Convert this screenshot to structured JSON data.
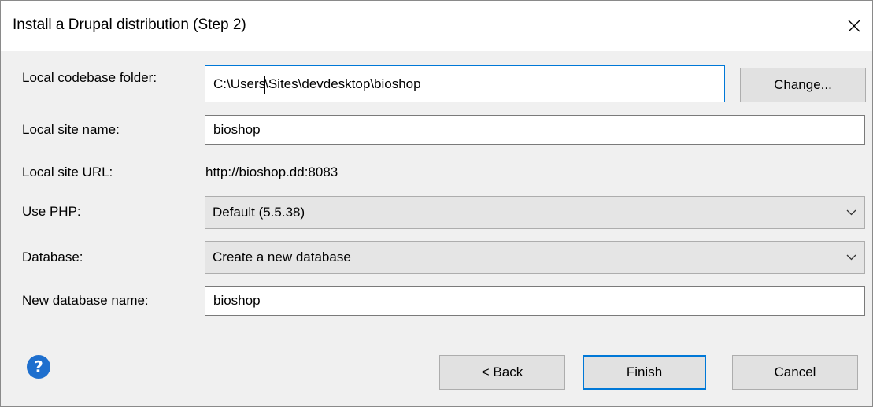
{
  "window": {
    "title": "Install a Drupal distribution (Step 2)"
  },
  "form": {
    "codebase": {
      "label": "Local codebase folder:",
      "value_before_caret": "C:\\Users",
      "value_after_caret": "\\Sites\\devdesktop\\bioshop",
      "change_label": "Change..."
    },
    "site_name": {
      "label": "Local site name:",
      "value": "bioshop"
    },
    "site_url": {
      "label": "Local site URL:",
      "value": "http://bioshop.dd:8083"
    },
    "php": {
      "label": "Use PHP:",
      "selected": "Default (5.5.38)"
    },
    "database": {
      "label": "Database:",
      "selected": "Create a new database"
    },
    "db_name": {
      "label": "New database name:",
      "value": "bioshop"
    }
  },
  "buttons": {
    "back": "< Back",
    "finish": "Finish",
    "cancel": "Cancel",
    "help": "?"
  },
  "icons": {
    "close": "close-icon",
    "chevron": "chevron-down-icon",
    "help": "help-icon"
  },
  "colors": {
    "accent": "#0078d7",
    "help": "#1e6fce"
  }
}
